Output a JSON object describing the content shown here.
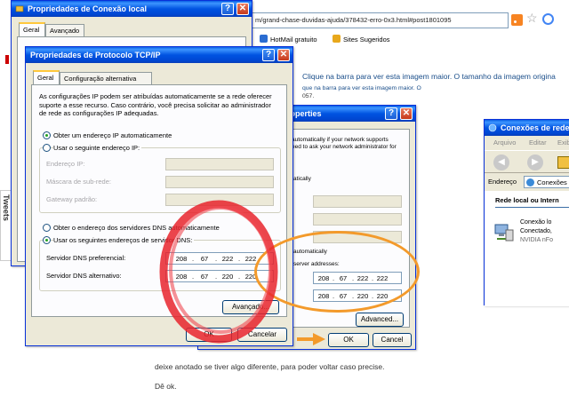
{
  "browser": {
    "url": "m/grand-chase-duvidas-ajuda/378432-erro-0x3.html#post1801095",
    "bookmarks": [
      "HotMail gratuito",
      "Sites Sugeridos"
    ],
    "text_line1": "Clique na barra para ver esta imagem maior. O tamanho da imagem origina",
    "text_line2": "que na barra para ver esta imagem maior. O",
    "text_line3": "057.",
    "bottom_line1": "deixe anotado se tiver algo diferente, para poder voltar caso precise.",
    "bottom_line2": "Dê ok.",
    "tweets_label": "Tweets"
  },
  "win_local": {
    "title": "Propriedades de Conexão local",
    "tabs": [
      "Geral",
      "Avançado"
    ]
  },
  "win_tcpip": {
    "title": "Propriedades de Protocolo TCP/IP",
    "tabs": [
      "Geral",
      "Configuração alternativa"
    ],
    "intro": "As configurações IP podem ser atribuídas automaticamente se a rede oferecer suporte a esse recurso. Caso contrário, você precisa solicitar ao administrador de rede as configurações IP adequadas.",
    "radio_auto_ip": "Obter um endereço IP automaticamente",
    "radio_manual_ip": "Usar o seguinte endereço IP:",
    "label_ip": "Endereço IP:",
    "label_mask": "Máscara de sub-rede:",
    "label_gateway": "Gateway padrão:",
    "radio_auto_dns": "Obter o endereço dos servidores DNS automaticamente",
    "radio_manual_dns": "Usar os seguintes endereços de servidor DNS:",
    "label_dns_pref": "Servidor DNS preferencial:",
    "label_dns_alt": "Servidor DNS alternativo:",
    "dns_pref": [
      "208",
      "67",
      "222",
      "222"
    ],
    "dns_alt": [
      "208",
      "67",
      "220",
      "220"
    ],
    "advanced_label": "Avançado...",
    "ok_label": "OK",
    "cancel_label": "Cancelar"
  },
  "win_en": {
    "title": "roperties",
    "intro": "automatically if your network supports\need to ask your network administrator for",
    "auto_label": "atically",
    "dns_auto": "automatically",
    "dns_manual": "server addresses:",
    "dns_pref": [
      "208",
      "67",
      "222",
      "222"
    ],
    "dns_alt": [
      "208",
      "67",
      "220",
      "220"
    ],
    "advanced_label": "Advanced...",
    "ok_label": "OK",
    "cancel_label": "Cancel"
  },
  "win_conn": {
    "title": "Conexões de rede",
    "menu": [
      "Arquivo",
      "Editar",
      "Exibir"
    ],
    "address_label": "Endereço",
    "address_value": "Conexões",
    "section": "Rede local ou Intern",
    "item_lines": [
      "Conexão lo",
      "Conectado,",
      "NVIDIA nFo"
    ]
  },
  "colors": {
    "xp_title": "#0053e1",
    "orange_annotation": "#f39a2b",
    "red_annotation": "#e8252d"
  }
}
